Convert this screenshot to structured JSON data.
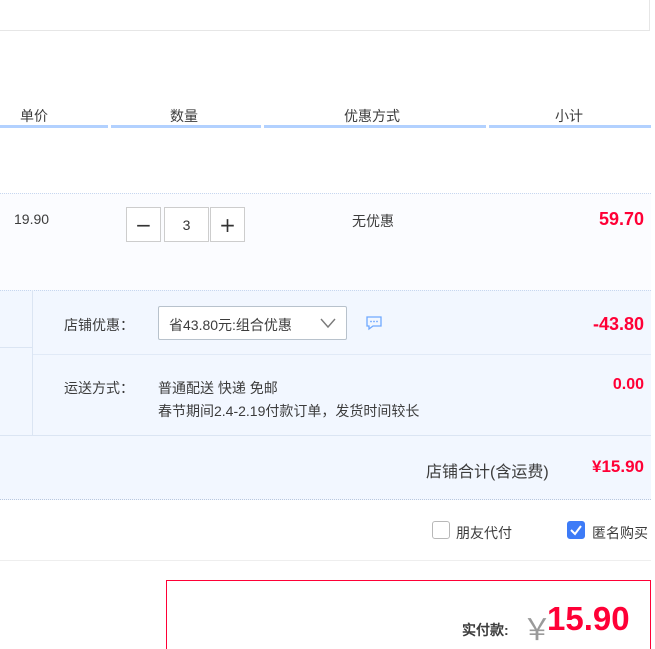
{
  "table_headers": {
    "unit_price": "单价",
    "quantity": "数量",
    "discount_method": "优惠方式",
    "subtotal": "小计"
  },
  "item": {
    "unit_price": "19.90",
    "quantity": "3",
    "decrease_label": "−",
    "increase_label": "+",
    "discount": "无优惠",
    "subtotal": "59.70"
  },
  "shop_promo": {
    "label": "店铺优惠：",
    "selected": "省43.80元:组合优惠",
    "amount": "-43.80"
  },
  "shipping": {
    "label": "运送方式：",
    "method": "普通配送 快递 免邮",
    "notice": "春节期间2.4-2.19付款订单，发货时间较长",
    "amount": "0.00"
  },
  "shop_total": {
    "label": "店铺合计(含运费)",
    "amount": "¥15.90"
  },
  "options": {
    "friend_pay": {
      "label": "朋友代付",
      "checked": false
    },
    "anonymous": {
      "label": "匿名购买",
      "checked": true
    }
  },
  "payment": {
    "label": "实付款:",
    "currency": "￥",
    "amount": "15.90"
  },
  "colors": {
    "accent_red": "#ff0036",
    "header_underline": "#b2d1ff",
    "checkbox_blue": "#3d7bf7"
  }
}
